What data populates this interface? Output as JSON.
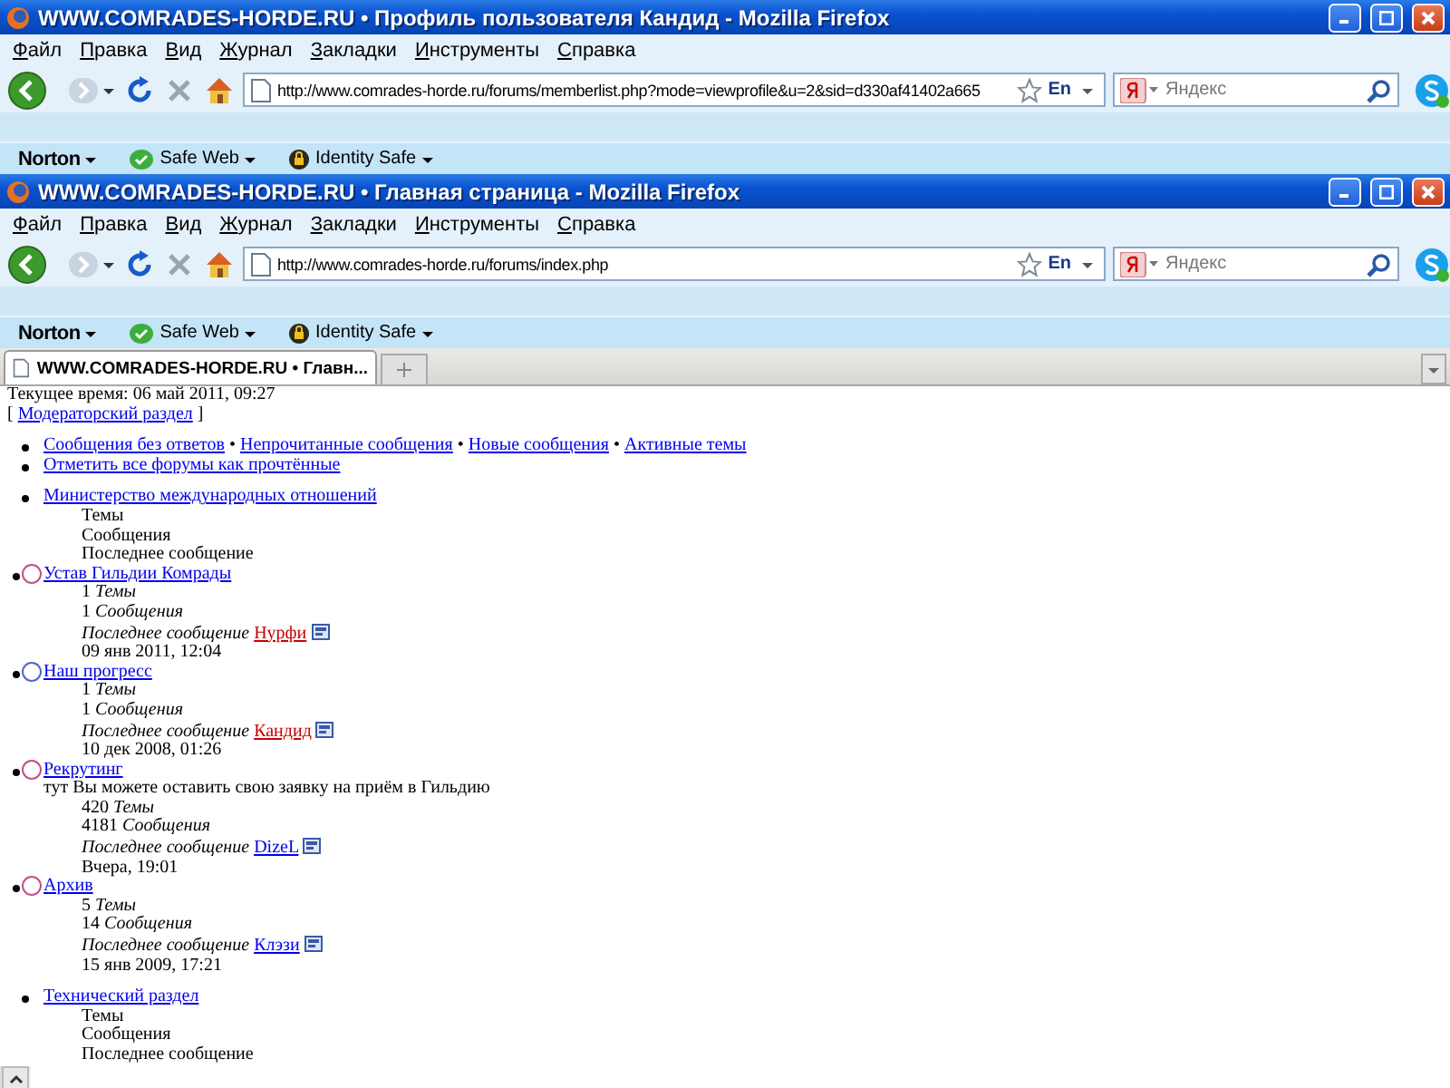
{
  "windows": [
    {
      "title": "WWW.COMRADES-HORDE.RU • Профиль пользователя Кандид - Mozilla Firefox",
      "menu": [
        "Файл",
        "Правка",
        "Вид",
        "Журнал",
        "Закладки",
        "Инструменты",
        "Справка"
      ],
      "url": "http://www.comrades-horde.ru/forums/memberlist.php?mode=viewprofile&u=2&sid=d330af41402a665",
      "language": "En",
      "search_placeholder": "Яндекс",
      "norton": {
        "brand": "Norton",
        "items": [
          "Safe Web",
          "Identity Safe"
        ]
      }
    },
    {
      "title": "WWW.COMRADES-HORDE.RU • Главная страница - Mozilla Firefox",
      "menu": [
        "Файл",
        "Правка",
        "Вид",
        "Журнал",
        "Закладки",
        "Инструменты",
        "Справка"
      ],
      "url": "http://www.comrades-horde.ru/forums/index.php",
      "language": "En",
      "search_placeholder": "Яндекс",
      "norton": {
        "brand": "Norton",
        "items": [
          "Safe Web",
          "Identity Safe"
        ]
      }
    }
  ],
  "tabs": [
    {
      "label": "WWW.COMRADES-HORDE.RU • Главн...",
      "selected": true
    }
  ],
  "page": {
    "time": "Текущее время: 06 май 2011, 09:27",
    "moderator": {
      "open": "[",
      "link": "Модераторский раздел",
      "close": "]"
    },
    "separator": "•",
    "quick_links": [
      [
        "Сообщения без ответов",
        "Непрочитанные сообщения",
        "Новые сообщения",
        "Активные темы"
      ],
      [
        "Отметить все форумы как прочтённые"
      ]
    ],
    "categories": [
      {
        "name": "Министерство международных отношений",
        "stat_labels": [
          "Темы",
          "Сообщения",
          "Последнее сообщение"
        ],
        "forums": [
          {
            "name": "Устав Гильдии Комрады",
            "color": "#c0508c",
            "topics": "1",
            "topics_label": "Темы",
            "posts": "1",
            "posts_label": "Сообщения",
            "last_label": "Последнее сообщение",
            "last_author": {
              "name": "Нурфи",
              "color": "#cc0000"
            },
            "last_time": "09 янв 2011, 12:04"
          },
          {
            "name": "Наш прогресс",
            "color": "#5068c8",
            "topics": "1",
            "topics_label": "Темы",
            "posts": "1",
            "posts_label": "Сообщения",
            "last_label": "Последнее сообщение",
            "last_author": {
              "name": "Кандид",
              "color": "#cc0000"
            },
            "last_time": "10 дек 2008, 01:26"
          },
          {
            "name": "Рекрутинг",
            "color": "#c0508c",
            "description": "тут Вы можете оставить свою заявку на приём в Гильдию",
            "topics": "420",
            "topics_label": "Темы",
            "posts": "4181",
            "posts_label": "Сообщения",
            "last_label": "Последнее сообщение",
            "last_author": {
              "name": "DizeL",
              "color": "#0000ee"
            },
            "last_time": "Вчера, 19:01"
          },
          {
            "name": "Архив",
            "color": "#c0508c",
            "topics": "5",
            "topics_label": "Темы",
            "posts": "14",
            "posts_label": "Сообщения",
            "last_label": "Последнее сообщение",
            "last_author": {
              "name": "Клэзи",
              "color": "#0000ee"
            },
            "last_time": "15 янв 2009, 17:21"
          }
        ]
      },
      {
        "name": "Технический раздел",
        "stat_labels": [
          "Темы",
          "Сообщения",
          "Последнее сообщение"
        ]
      }
    ]
  }
}
